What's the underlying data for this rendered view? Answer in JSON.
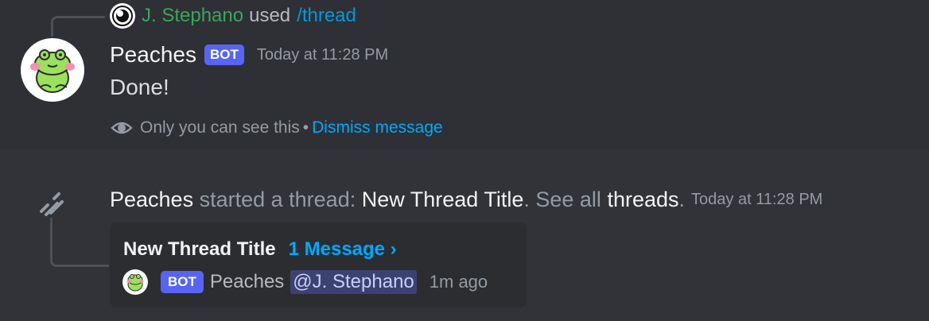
{
  "reply": {
    "user": "J. Stephano",
    "used": "used",
    "command": "/thread"
  },
  "message": {
    "username": "Peaches",
    "bot_tag": "BOT",
    "timestamp": "Today at 11:28 PM",
    "content": "Done!",
    "ephemeral": {
      "note": "Only you can see this",
      "separator": "•",
      "dismiss": "Dismiss message"
    }
  },
  "system": {
    "actor": "Peaches",
    "action": "started a thread:",
    "thread_name": "New Thread Title",
    "period1": ".",
    "see_all": "See all",
    "threads_link": "threads",
    "period2": ".",
    "timestamp": "Today at 11:28 PM"
  },
  "thread_card": {
    "title": "New Thread Title",
    "message_count": "1 Message ›",
    "bot_tag": "BOT",
    "author": "Peaches",
    "mention": "@J. Stephano",
    "time_ago": "1m ago"
  },
  "colors": {
    "background": "#313338",
    "highlight_background": "#2e3035",
    "bot_tag": "#5865f2",
    "link": "#00a8fc",
    "reply_user": "#3ba55c"
  },
  "icons": {
    "reply_avatar": "discord-avatar-icon",
    "bot_avatar": "frog-avatar-icon",
    "ephemeral": "eye-icon",
    "thread": "thread-icon"
  }
}
